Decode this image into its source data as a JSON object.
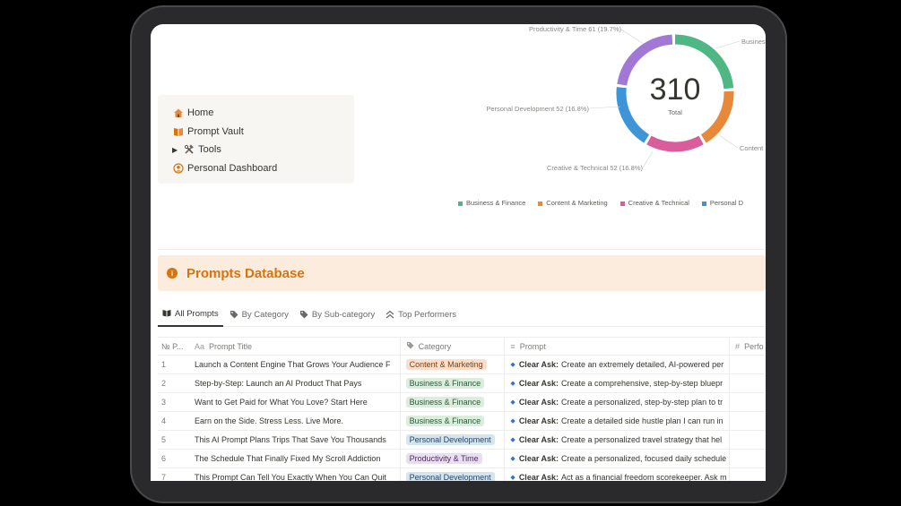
{
  "nav": {
    "items": [
      {
        "label": "Home",
        "icon": "home-icon"
      },
      {
        "label": "Prompt Vault",
        "icon": "book-icon"
      },
      {
        "label": "Tools",
        "icon": "hammer-wrench-icon",
        "toggle": true
      },
      {
        "label": "Personal Dashboard",
        "icon": "person-circle-icon"
      }
    ]
  },
  "chart_data": {
    "type": "pie",
    "total": "310",
    "total_label": "Total",
    "slices": [
      {
        "name": "Business & Finance",
        "color": "#4fb784",
        "visible_label": "Business"
      },
      {
        "name": "Content & Marketing",
        "color": "#e8893a",
        "visible_label": "Content"
      },
      {
        "name": "Creative & Technical",
        "value": 52,
        "percent": "16.8%",
        "color": "#d95d9a",
        "visible_label": "Creative & Technical  52 (16.8%)"
      },
      {
        "name": "Personal Development",
        "value": 52,
        "percent": "16.8%",
        "color": "#3d94d6",
        "visible_label": "Personal Development  52 (16.8%)"
      },
      {
        "name": "Productivity & Time",
        "value": 61,
        "percent": "19.7%",
        "color": "#a178d6",
        "visible_label": "Productivity & Time  61 (19.7%)"
      }
    ],
    "legend": [
      "Business & Finance",
      "Content & Marketing",
      "Creative & Technical",
      "Personal D"
    ]
  },
  "callout": {
    "title": "Prompts Database"
  },
  "tabs": [
    {
      "label": "All Prompts",
      "icon": "book-icon",
      "active": true
    },
    {
      "label": "By Category",
      "icon": "tag-icon"
    },
    {
      "label": "By Sub-category",
      "icon": "tag-icon"
    },
    {
      "label": "Top Performers",
      "icon": "double-chevron-up-icon"
    }
  ],
  "table": {
    "headers": {
      "num": "№  P...",
      "title": "Prompt Title",
      "category": "Category",
      "prompt": "Prompt",
      "perf": "Perfo"
    },
    "rows": [
      {
        "num": "1",
        "title": "Launch a Content Engine That Grows Your Audience F",
        "category": "Content & Marketing",
        "cat_color": "content",
        "lead": "Clear Ask:",
        "prompt": "Create an extremely detailed, AI-powered per"
      },
      {
        "num": "2",
        "title": "Step-by-Step: Launch an AI Product That Pays",
        "category": "Business & Finance",
        "cat_color": "business",
        "lead": "Clear Ask:",
        "prompt": "Create a comprehensive, step-by-step bluepr"
      },
      {
        "num": "3",
        "title": "Want to Get Paid for What You Love? Start Here",
        "category": "Business & Finance",
        "cat_color": "business",
        "lead": "Clear Ask:",
        "prompt": "Create a personalized, step-by-step plan to tr"
      },
      {
        "num": "4",
        "title": "Earn on the Side. Stress Less. Live More.",
        "category": "Business & Finance",
        "cat_color": "business",
        "lead": "Clear Ask:",
        "prompt": "Create a detailed side hustle plan I can run in"
      },
      {
        "num": "5",
        "title": "This AI Prompt Plans Trips That Save You Thousands",
        "category": "Personal Development",
        "cat_color": "personal",
        "lead": "Clear Ask:",
        "prompt": "Create a personalized travel strategy that hel"
      },
      {
        "num": "6",
        "title": "The Schedule That Finally Fixed My Scroll Addiction",
        "category": "Productivity & Time",
        "cat_color": "productivity",
        "lead": "Clear Ask:",
        "prompt": "Create a personalized, focused daily schedule"
      },
      {
        "num": "7",
        "title": "This Prompt Can Tell You Exactly When You Can Quit",
        "category": "Personal Development",
        "cat_color": "personal",
        "lead": "Clear Ask:",
        "prompt": "Act as a financial freedom scorekeeper. Ask m"
      }
    ]
  }
}
